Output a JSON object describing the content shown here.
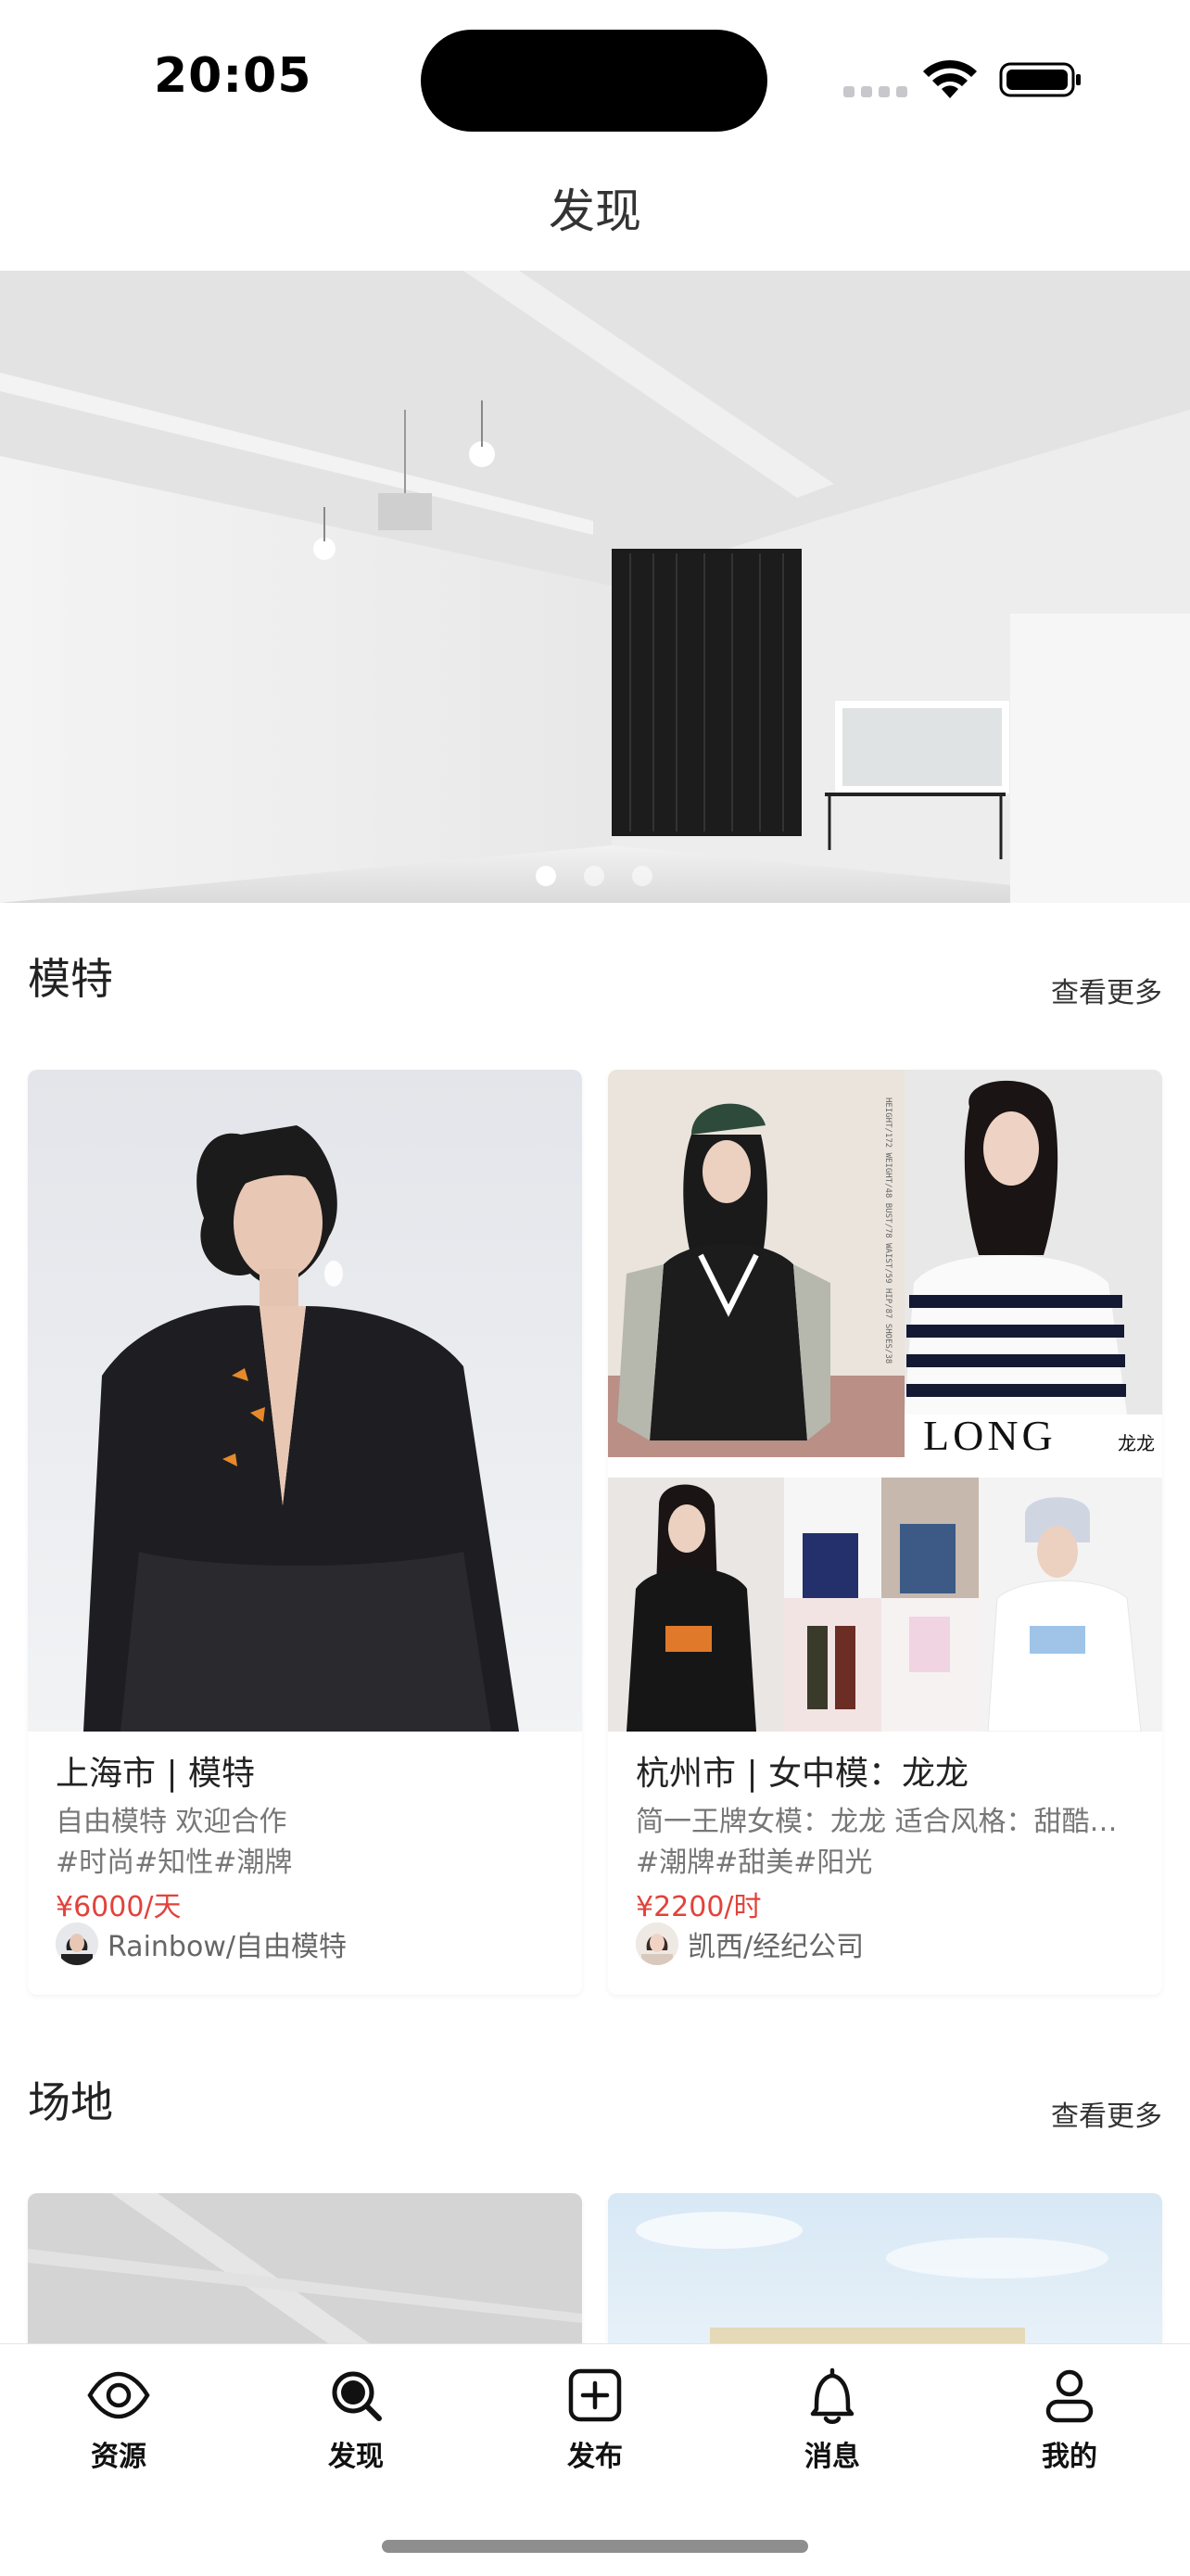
{
  "status_bar": {
    "time": "20:05"
  },
  "header": {
    "title": "发现"
  },
  "banner": {
    "slide_count": 3,
    "active_index": 0
  },
  "models_section": {
    "title": "模特",
    "more_label": "查看更多",
    "cards": [
      {
        "title": "上海市 | 模特",
        "desc": "自由模特 欢迎合作",
        "tags": "#时尚#知性#潮牌",
        "price": "¥6000/天",
        "author": "Rainbow/自由模特"
      },
      {
        "title": "杭州市 | 女中模：龙龙",
        "desc": "简一王牌女模：龙龙  适合风格：甜酷…",
        "tags": "#潮牌#甜美#阳光",
        "price": "¥2200/时",
        "author": "凯西/经纪公司",
        "poster_text": "LONG",
        "poster_subtext": "龙龙"
      }
    ]
  },
  "venues_section": {
    "title": "场地",
    "more_label": "查看更多"
  },
  "tab_bar": {
    "tabs": [
      {
        "label": "资源",
        "icon": "eye-icon"
      },
      {
        "label": "发现",
        "icon": "search-icon"
      },
      {
        "label": "发布",
        "icon": "plus-square-icon"
      },
      {
        "label": "消息",
        "icon": "bell-icon"
      },
      {
        "label": "我的",
        "icon": "person-icon"
      }
    ],
    "active_index": 1
  },
  "colors": {
    "price": "#e2423b",
    "active_dot": "#ffffff"
  }
}
